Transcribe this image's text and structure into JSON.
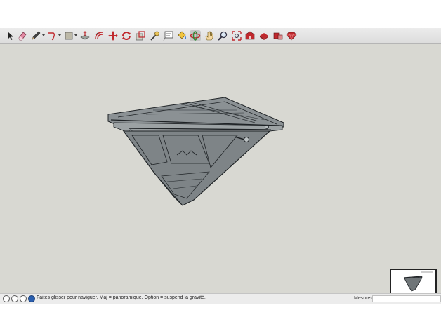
{
  "toolbar": {
    "tools": [
      {
        "name": "select-tool",
        "icon": "arrow-cursor-icon"
      },
      {
        "name": "eraser-tool",
        "icon": "eraser-icon"
      },
      {
        "name": "pencil-line-tool",
        "icon": "pencil-icon",
        "dropdown": true
      },
      {
        "name": "arc-tool",
        "icon": "arc-icon",
        "dropdown": true
      },
      {
        "name": "rectangle-tool",
        "icon": "rectangle-icon",
        "dropdown": true
      },
      {
        "name": "push-pull-tool",
        "icon": "push-pull-icon"
      },
      {
        "name": "offset-tool",
        "icon": "offset-icon"
      },
      {
        "name": "move-tool",
        "icon": "move-arrows-icon"
      },
      {
        "name": "rotate-tool",
        "icon": "rotate-icon"
      },
      {
        "name": "scale-tool",
        "icon": "scale-icon"
      },
      {
        "name": "tape-measure-tool",
        "icon": "tape-measure-icon"
      },
      {
        "name": "text-tool",
        "icon": "text-label-icon"
      },
      {
        "name": "paint-bucket-tool",
        "icon": "paint-bucket-icon"
      },
      {
        "name": "orbit-tool",
        "icon": "orbit-icon",
        "active": true
      },
      {
        "name": "pan-tool",
        "icon": "hand-icon"
      },
      {
        "name": "zoom-tool",
        "icon": "magnifier-icon"
      },
      {
        "name": "zoom-extents-tool",
        "icon": "zoom-extents-icon"
      },
      {
        "name": "warehouse-tool",
        "icon": "warehouse-icon"
      },
      {
        "name": "share-model-tool",
        "icon": "share-model-icon"
      },
      {
        "name": "extension-warehouse-tool",
        "icon": "extension-icon"
      },
      {
        "name": "ruby-console-tool",
        "icon": "ruby-gem-icon"
      }
    ]
  },
  "status": {
    "hint": "Faites glisser pour naviguer. Maj = panoramique, Option =  suspend la gravité.",
    "measurements_label": "Mesures",
    "measurements_value": ""
  },
  "colors": {
    "viewport_bg": "#d8d8d2",
    "model_fill": "#7e8487",
    "model_edge": "#1f2326",
    "accent_red": "#c0282d"
  }
}
